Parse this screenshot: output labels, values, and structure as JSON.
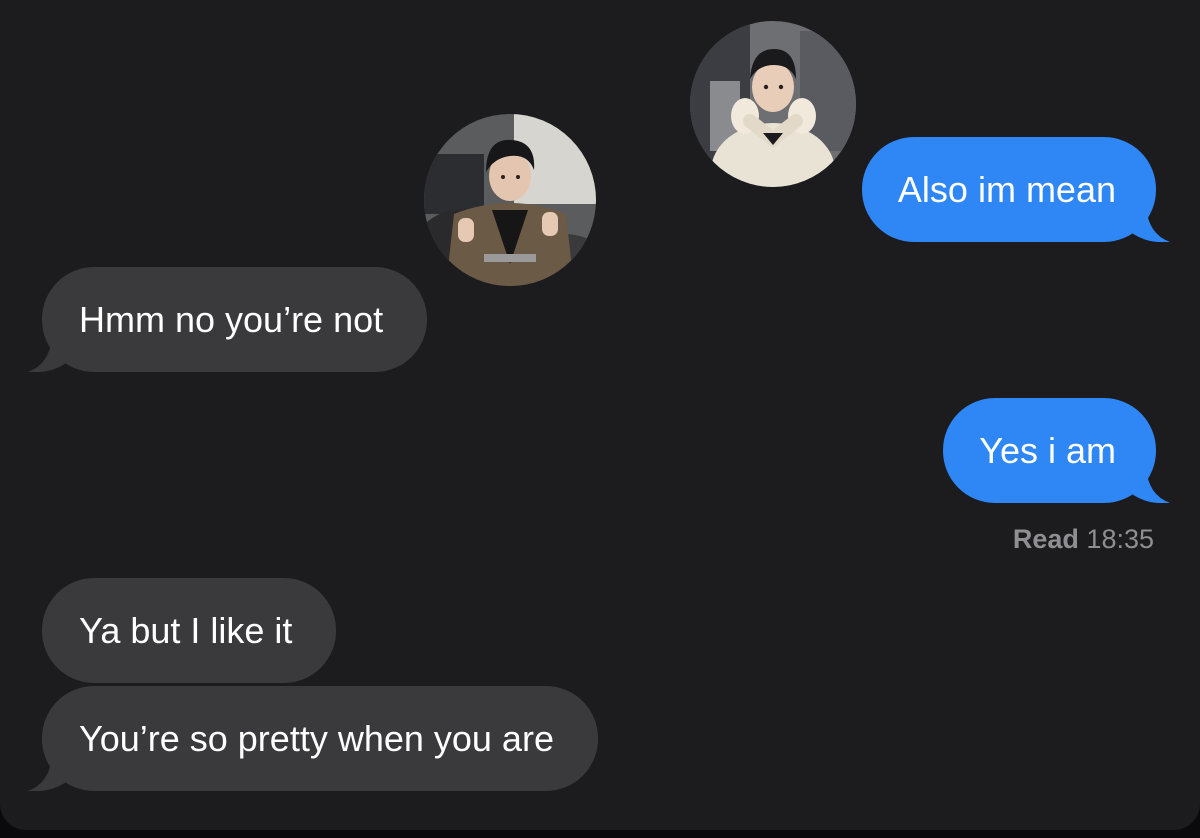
{
  "conversation": {
    "messages": [
      {
        "direction": "outgoing",
        "text": "Also im mean"
      },
      {
        "direction": "incoming",
        "text": "Hmm no you’re not"
      },
      {
        "direction": "outgoing",
        "text": "Yes i am"
      },
      {
        "direction": "incoming",
        "text": "Ya but I like it"
      },
      {
        "direction": "incoming",
        "text": "You’re so pretty when you are"
      }
    ],
    "read_receipt": {
      "label": "Read",
      "time": "18:35"
    }
  },
  "stickers": [
    {
      "subject": "person in cream sweater making heart hands"
    },
    {
      "subject": "person in brown jacket giving thumbs up"
    }
  ],
  "colors": {
    "background": "#1c1c1e",
    "incoming_bubble": "#3a3a3c",
    "outgoing_bubble": "#2f86f5",
    "text": "#ffffff",
    "receipt_text": "#8e8e93"
  }
}
